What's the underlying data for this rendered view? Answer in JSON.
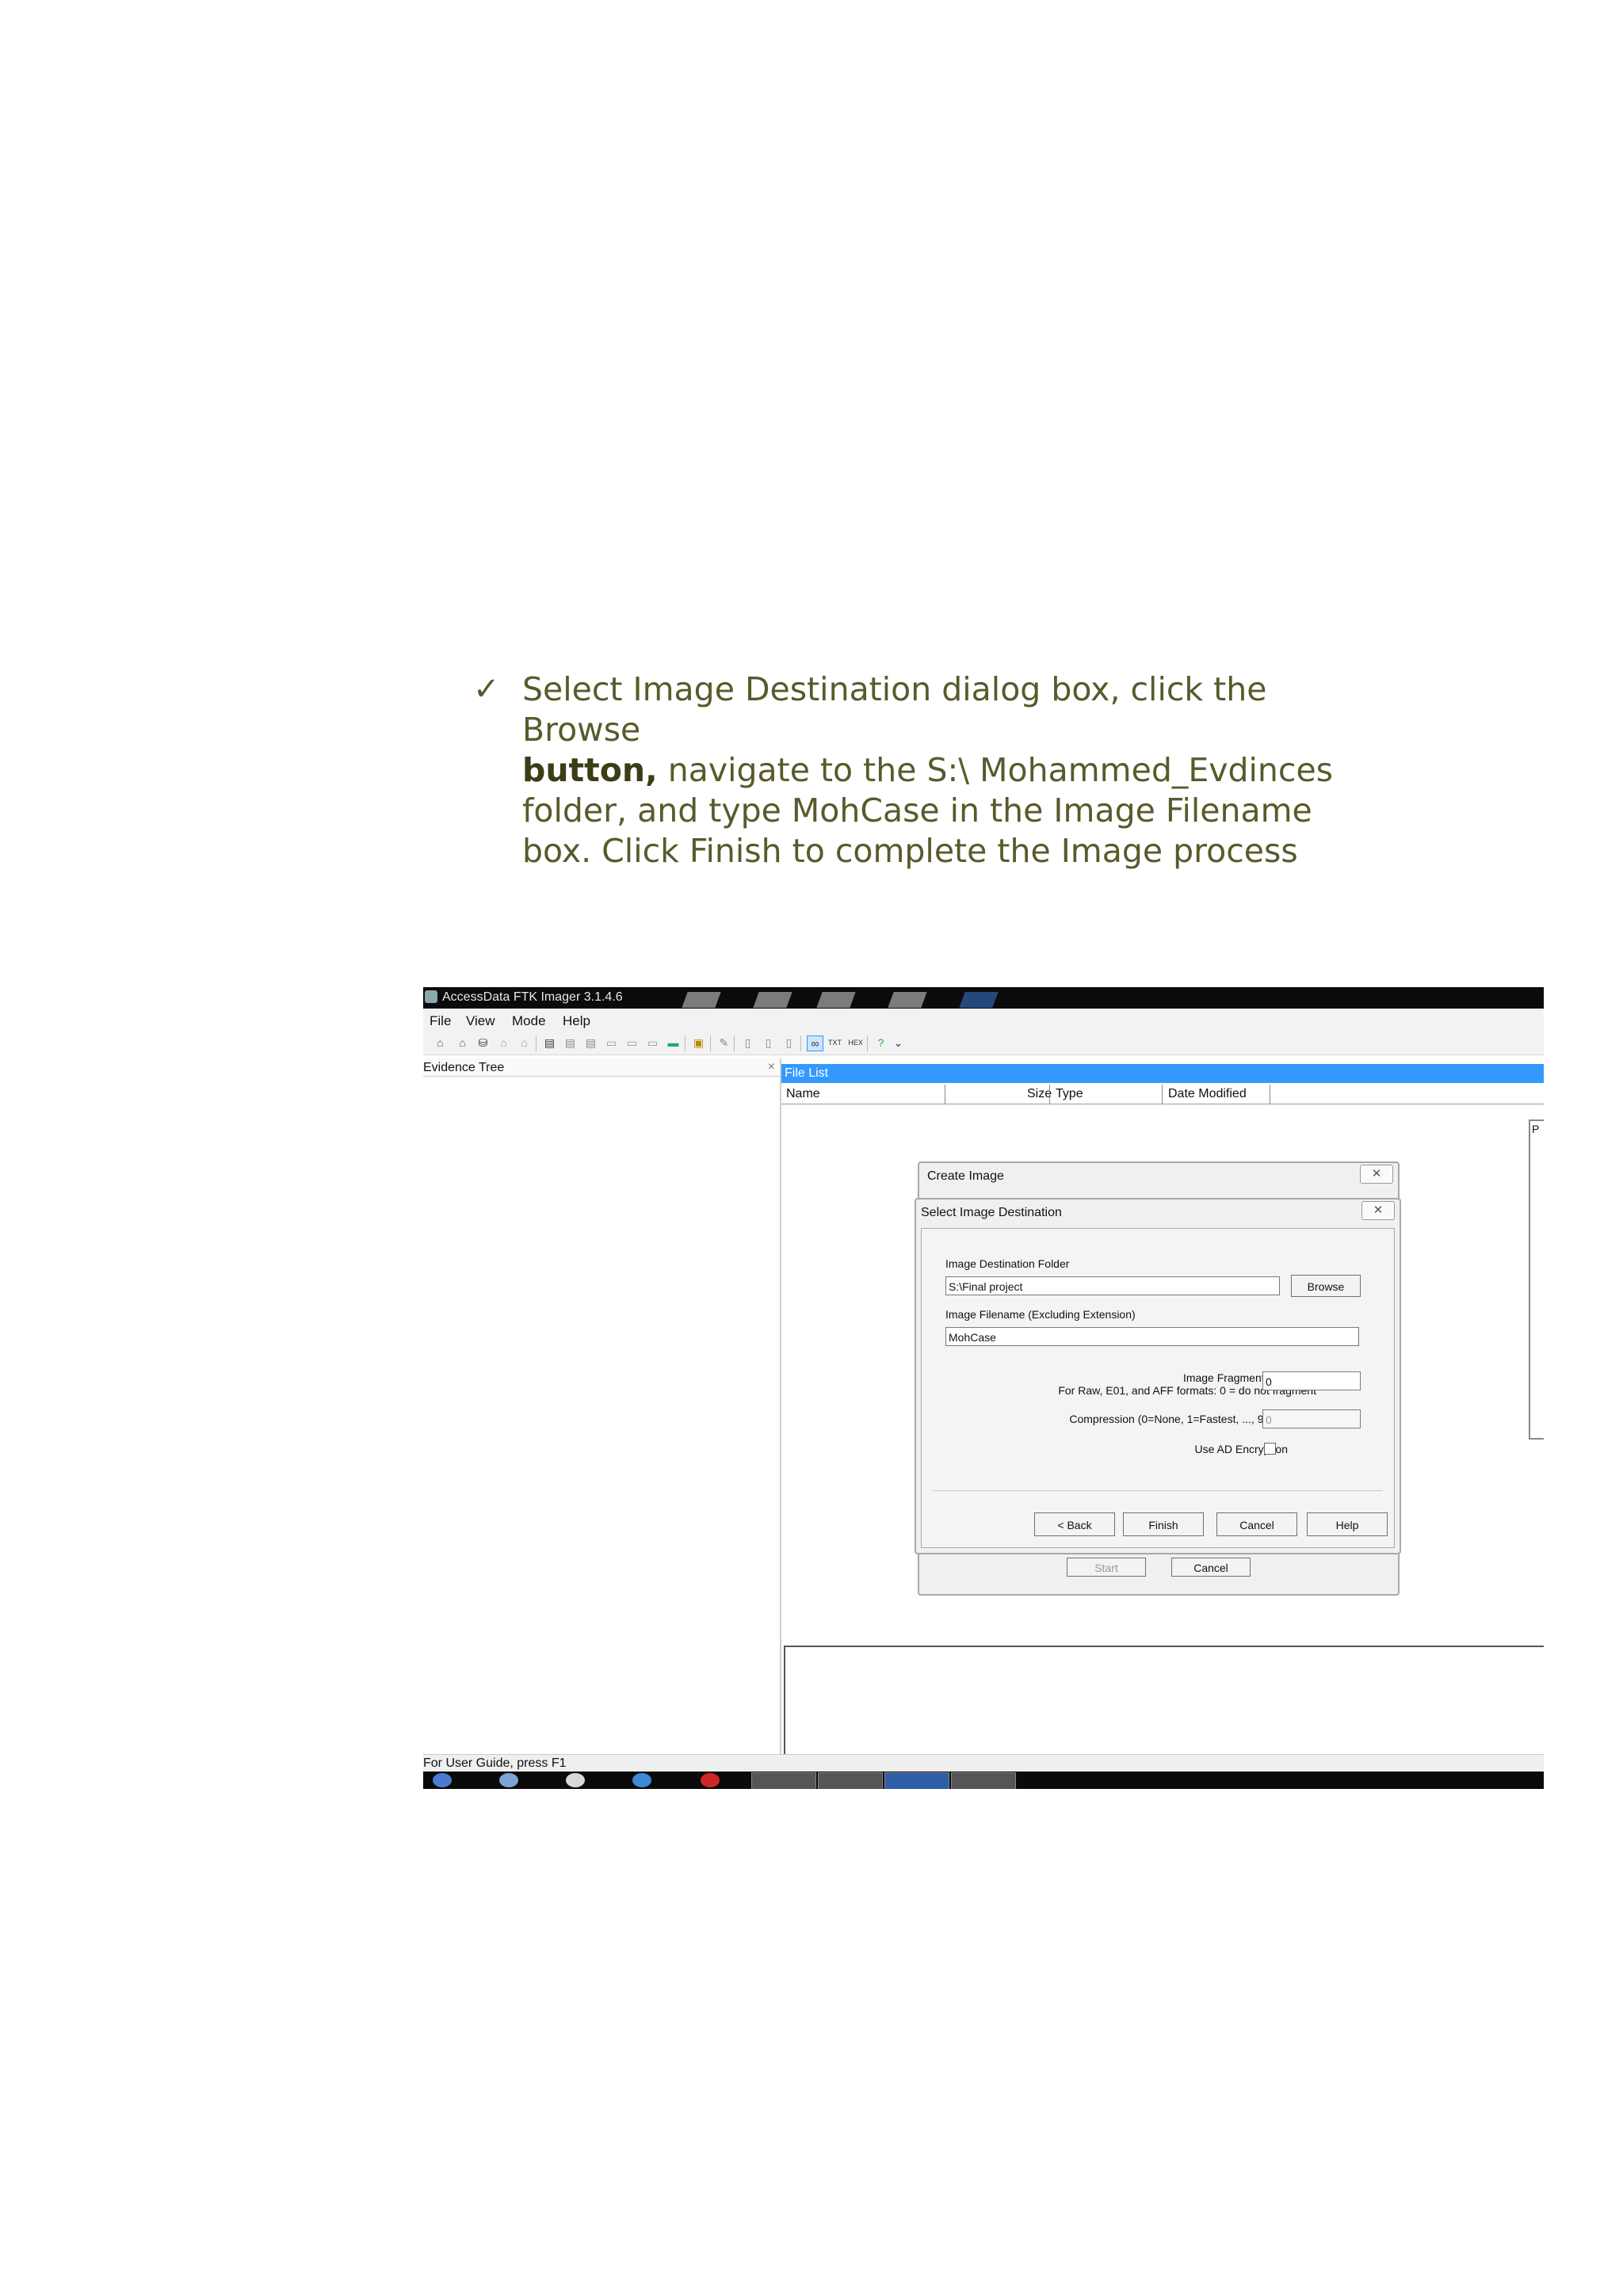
{
  "instruction": {
    "check": "✓",
    "line1": "Select Image Destination dialog box, click the Browse",
    "bold": "button,",
    "line2_rest": " navigate to the S:\\ Mohammed_Evdinces",
    "line3": "folder, and type MohCase in the Image Filename",
    "line4": "box. Click Finish to complete the Image process"
  },
  "app": {
    "title": "AccessData FTK Imager 3.1.4.6",
    "menu": [
      "File",
      "View",
      "Mode",
      "Help"
    ],
    "evidence_tree": "Evidence Tree",
    "file_list": "File List",
    "columns": [
      "Name",
      "Size",
      "Type",
      "Date Modified"
    ],
    "status": "For User Guide, press F1",
    "panel_letter": "P"
  },
  "create_image": {
    "title": "Create Image",
    "start": "Start",
    "cancel": "Cancel"
  },
  "select_dest": {
    "title": "Select Image Destination",
    "folder_label": "Image Destination Folder",
    "folder_value": "S:\\Final project",
    "browse": "Browse",
    "filename_label": "Image Filename (Excluding Extension)",
    "filename_value": "MohCase",
    "fragment_label": "Image Fragment Size (MB)",
    "fragment_note": "For Raw, E01, and AFF formats: 0 = do not fragment",
    "fragment_value": "0",
    "compression_label": "Compression (0=None, 1=Fastest, ..., 9=Smallest)",
    "compression_value": "0",
    "encryption_label": "Use AD Encryption",
    "back": "< Back",
    "finish": "Finish",
    "cancel": "Cancel",
    "help": "Help"
  }
}
